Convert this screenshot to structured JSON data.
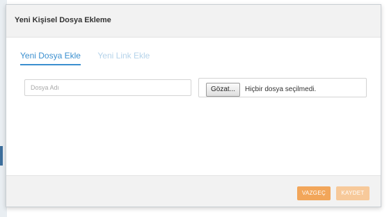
{
  "dialog": {
    "title": "Yeni Kişisel Dosya Ekleme"
  },
  "tabs": [
    {
      "label": "Yeni Dosya Ekle",
      "active": true
    },
    {
      "label": "Yeni Link Ekle",
      "active": false
    }
  ],
  "form": {
    "filename_placeholder": "Dosya Adı",
    "filename_value": "",
    "browse_label": "Gözat...",
    "file_status": "Hiçbir dosya seçilmedi."
  },
  "footer": {
    "cancel_label": "VAZGEÇ",
    "save_label": "KAYDET"
  },
  "colors": {
    "accent": "#3a8fcf",
    "cancel_button": "#f2a65a",
    "save_button_disabled": "#f7c99a"
  }
}
